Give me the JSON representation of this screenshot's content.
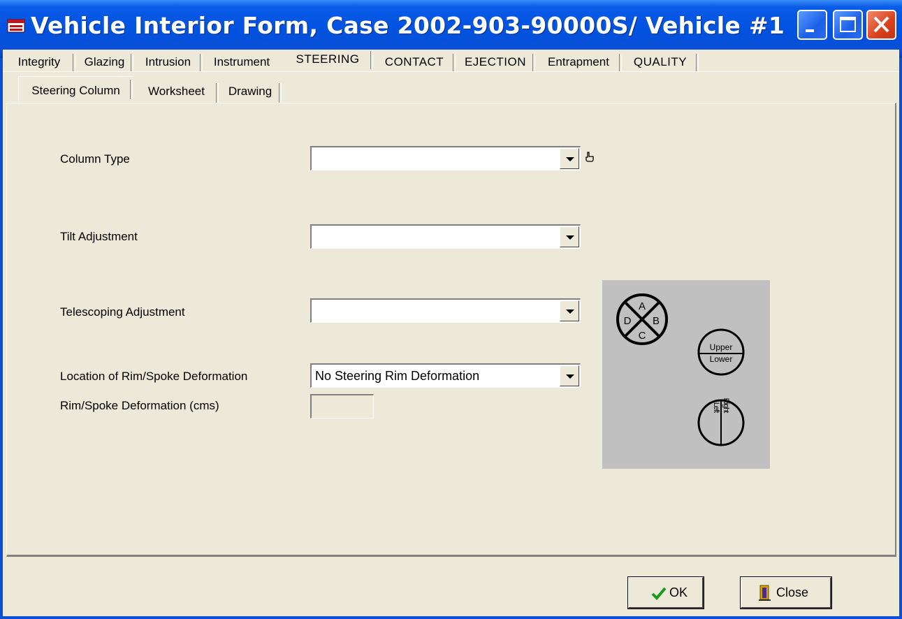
{
  "window": {
    "title": "Vehicle Interior Form, Case 2002-903-90000S/ Vehicle #1",
    "controls": {
      "minimize": "minimize-icon",
      "maximize": "maximize-icon",
      "close": "close-icon"
    }
  },
  "main_tabs": [
    "Integrity",
    "Glazing",
    "Intrusion",
    "Instrument",
    "STEERING",
    "CONTACT",
    "EJECTION",
    "Entrapment",
    "QUALITY"
  ],
  "active_main_tab": "STEERING",
  "sub_tabs": [
    "Steering Column",
    "Worksheet",
    "Drawing"
  ],
  "active_sub_tab": "Steering Column",
  "form": {
    "column_type": {
      "label": "Column Type",
      "value": ""
    },
    "tilt_adjustment": {
      "label": "Tilt Adjustment",
      "value": ""
    },
    "telescoping_adjustment": {
      "label": "Telescoping Adjustment",
      "value": ""
    },
    "rim_location": {
      "label": "Location of Rim/Spoke Deformation",
      "value": "No Steering Rim Deformation"
    },
    "rim_deformation": {
      "label": "Rim/Spoke Deformation (cms)",
      "value": ""
    }
  },
  "diagram": {
    "quadrants": [
      "A",
      "B",
      "C",
      "D"
    ],
    "upper": "Upper",
    "lower": "Lower",
    "left": "Left",
    "right": "Right"
  },
  "buttons": {
    "ok": "OK",
    "close": "Close"
  },
  "colors": {
    "title_bar": "#0a4fd6",
    "window_bg": "#ece9d8",
    "diagram_bg": "#c0c0c0",
    "ok_check": "#1a9a1a"
  }
}
